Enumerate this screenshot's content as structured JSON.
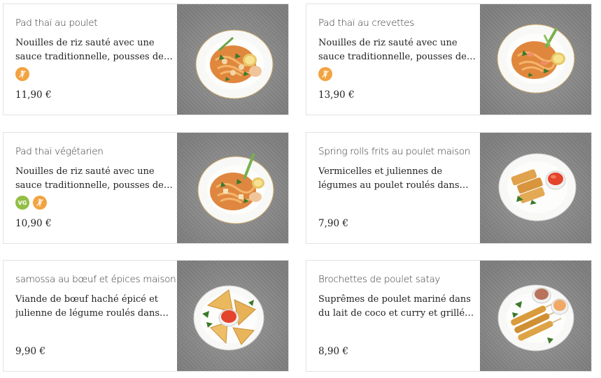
{
  "menu": {
    "items": [
      {
        "title": "Pad thaï au poulet",
        "description": "Nouilles de riz sauté avec une sauce traditionnelle, pousses de soja,...",
        "price": "11,90 €",
        "badges": [
          {
            "icon": "gluten-free-icon",
            "color": "#f2a341"
          }
        ],
        "photo": "pad-thai-plate"
      },
      {
        "title": "Pad thaï au crevettes",
        "description": "Nouilles de riz sauté avec une sauce traditionnelle, pousses de soja,...",
        "price": "13,90 €",
        "badges": [
          {
            "icon": "gluten-free-icon",
            "color": "#f2a341"
          }
        ],
        "photo": "pad-thai-plate"
      },
      {
        "title": "Pad thaï végétarien",
        "description": "Nouilles de riz sauté avec une sauce traditionnelle, pousses de soja,...",
        "price": "10,90 €",
        "badges": [
          {
            "icon": "vegan-icon",
            "label": "VG",
            "color": "#93bf45"
          },
          {
            "icon": "gluten-free-icon",
            "color": "#f2a341"
          }
        ],
        "photo": "pad-thai-plate"
      },
      {
        "title": "Spring rolls frits au poulet maison",
        "description": "Vermicelles et juliennes de légumes au poulet roulés dans une feuille de...",
        "price": "7,90 €",
        "badges": [],
        "photo": "spring-rolls-plate"
      },
      {
        "title": "samossa au bœuf et épices maison",
        "description": "Viande de bœuf haché épicé et julienne de légume roulés dans une...",
        "price": "9,90 €",
        "badges": [],
        "photo": "samossa-plate"
      },
      {
        "title": "Brochettes de poulet satay",
        "description": "Suprêmes de poulet mariné dans du lait de coco et curry et grillé à la...",
        "price": "8,90 €",
        "badges": [],
        "photo": "satay-plate"
      }
    ]
  }
}
